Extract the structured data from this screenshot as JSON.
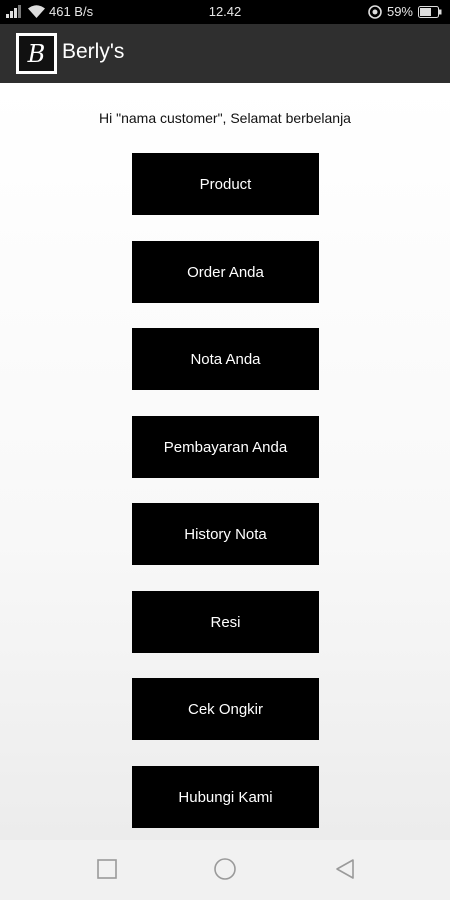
{
  "status_bar": {
    "network_speed": "461 B/s",
    "time": "12.42",
    "battery": "59%"
  },
  "app": {
    "title": "Berly's",
    "logo_letter": "B"
  },
  "greeting": "Hi \"nama customer\", Selamat berbelanja",
  "menu": [
    {
      "label": "Product"
    },
    {
      "label": "Order Anda"
    },
    {
      "label": "Nota Anda"
    },
    {
      "label": "Pembayaran Anda"
    },
    {
      "label": "History Nota"
    },
    {
      "label": "Resi"
    },
    {
      "label": "Cek Ongkir"
    },
    {
      "label": "Hubungi Kami"
    }
  ],
  "icons": [
    "signal-icon",
    "wifi-icon",
    "vpn-icon",
    "battery-icon",
    "recents-icon",
    "home-icon",
    "back-icon"
  ]
}
